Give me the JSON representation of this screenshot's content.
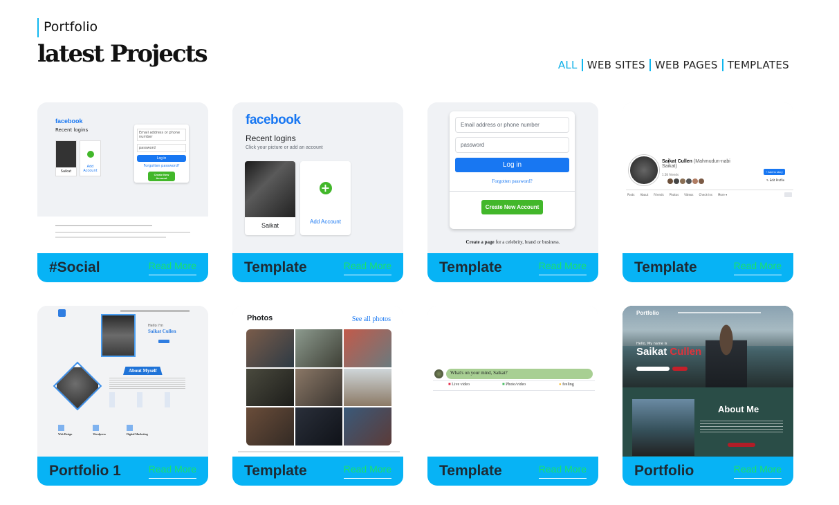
{
  "header": {
    "section_label": "Portfolio",
    "title": "latest Projects"
  },
  "filters": [
    "ALL",
    "WEB SITES",
    "WEB PAGES",
    "TEMPLATES"
  ],
  "projects": [
    {
      "name": "#Social",
      "read_more": "Read More"
    },
    {
      "name": "Template",
      "read_more": "Read More"
    },
    {
      "name": "Template",
      "read_more": "Read More"
    },
    {
      "name": "Template",
      "read_more": "Read More"
    },
    {
      "name": "Portfolio 1",
      "read_more": "Read More"
    },
    {
      "name": "Template",
      "read_more": "Read More"
    },
    {
      "name": "Template",
      "read_more": "Read More"
    },
    {
      "name": "Portfolio",
      "read_more": "Read More"
    }
  ],
  "thumbs": {
    "fb_small": {
      "brand": "facebook",
      "recent": "Recent logins",
      "user": "Saikat",
      "add": "Add Account",
      "email": "Email address or phone number",
      "password": "password",
      "login": "Log in",
      "forgot": "Forgotten password?",
      "create": "Create New Account"
    },
    "fb_large": {
      "brand": "facebook",
      "recent": "Recent logins",
      "sub": "Click your picture or add an account",
      "user": "Saikat",
      "add": "Add Account"
    },
    "fb_form": {
      "email": "Email address or phone number",
      "password": "password",
      "login": "Log in",
      "forgot": "Forgotten password?",
      "create": "Create New Account",
      "page_note_bold": "Create a page",
      "page_note": " for a celebrity, brand or business."
    },
    "profile": {
      "name": "Saikat Cullen",
      "alt_name": "(Mahmudun-nabi Saikat)",
      "friends": "1.5K friends",
      "add_story": "+ Add to story",
      "edit": "✎ Edit Profile",
      "tabs": [
        "Posts",
        "About",
        "Friends",
        "Photos",
        "Videos",
        "Check-ins",
        "More ▾"
      ]
    },
    "portfolio1": {
      "about": "About Myself",
      "hello": "Hello I'm",
      "name": "Saikat Cullen",
      "services": [
        "Web Design",
        "Wordpress",
        "Digital Marketing"
      ]
    },
    "photos": {
      "title": "Photos",
      "link": "See all photos"
    },
    "composer": {
      "prompt": "What's on your mind, Saikat?",
      "live": "Live video",
      "photo": "Photo/video",
      "feeling": "feeling"
    },
    "portfolio": {
      "brand": "Portfolio",
      "hello": "Hello, My name is",
      "first": "Saikat",
      "last": "Cullen",
      "about": "About Me"
    }
  }
}
